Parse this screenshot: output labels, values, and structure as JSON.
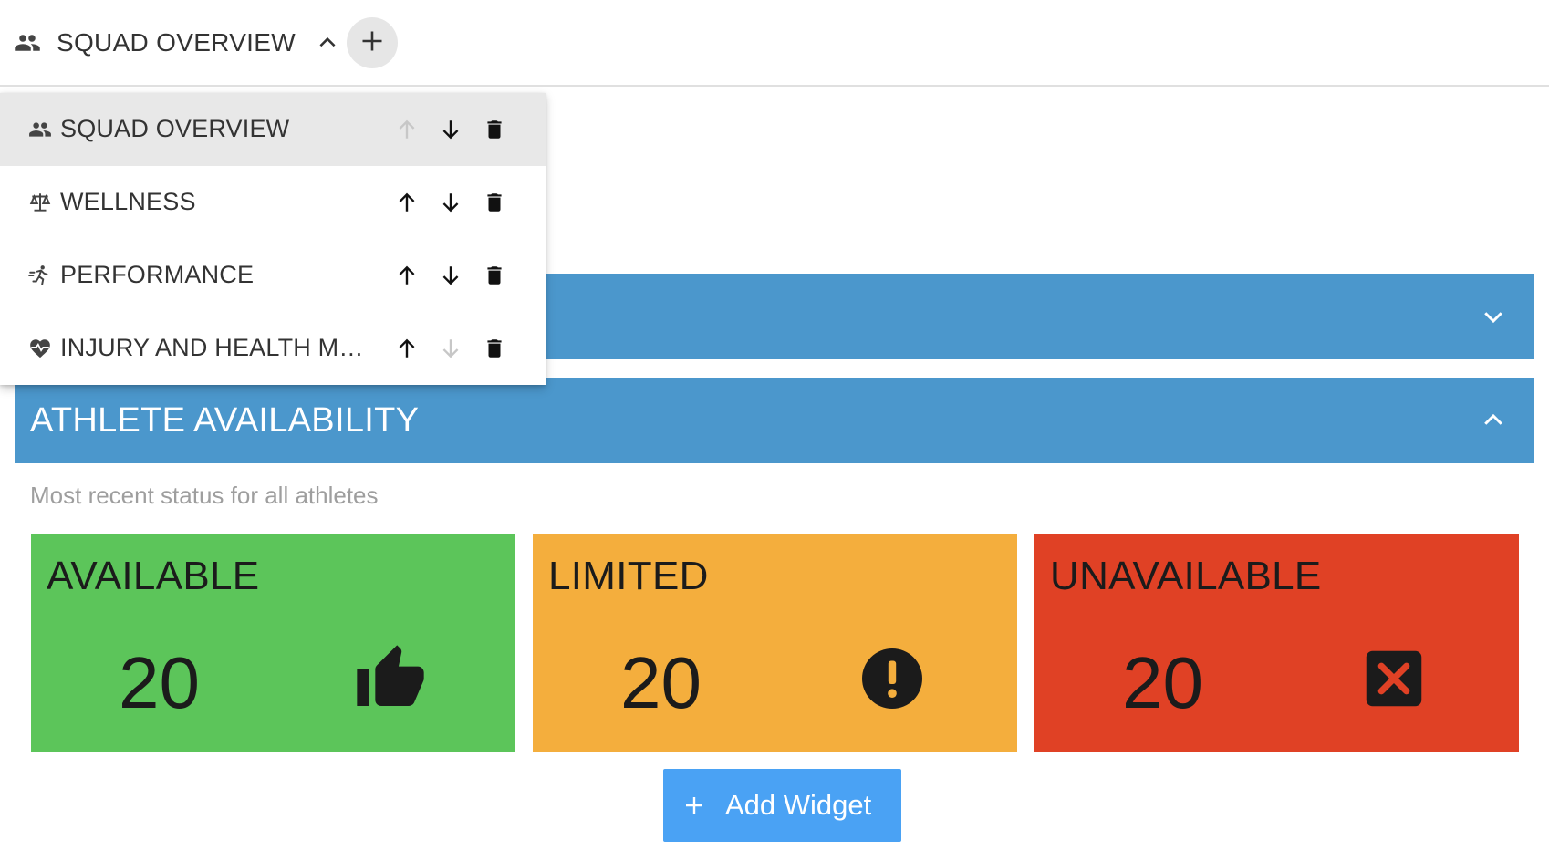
{
  "topbar": {
    "current_dashboard": "SQUAD OVERVIEW",
    "current_icon": "group-icon",
    "add_icon": "plus-icon"
  },
  "menu": {
    "items": [
      {
        "label": "SQUAD OVERVIEW",
        "icon": "group-icon",
        "selected": true,
        "up_enabled": false,
        "down_enabled": true
      },
      {
        "label": "WELLNESS",
        "icon": "scale-balance-icon",
        "selected": false,
        "up_enabled": true,
        "down_enabled": true
      },
      {
        "label": "PERFORMANCE",
        "icon": "running-person-icon",
        "selected": false,
        "up_enabled": true,
        "down_enabled": true
      },
      {
        "label": "INJURY AND HEALTH MA…",
        "icon": "heart-pulse-icon",
        "selected": false,
        "up_enabled": true,
        "down_enabled": false
      }
    ]
  },
  "availability": {
    "title": "ATHLETE AVAILABILITY",
    "subtitle": "Most recent status for all athletes",
    "cards": [
      {
        "label": "AVAILABLE",
        "value": "20",
        "color": "#5cc55a",
        "icon": "thumbs-up-icon"
      },
      {
        "label": "LIMITED",
        "value": "20",
        "color": "#f4ae3d",
        "icon": "exclamation-circle-icon"
      },
      {
        "label": "UNAVAILABLE",
        "value": "20",
        "color": "#e04125",
        "icon": "close-box-icon"
      }
    ]
  },
  "add_widget": {
    "label": "Add Widget"
  },
  "colors": {
    "panel_header": "#4b97cc",
    "add_widget_bg": "#4aa2f4"
  }
}
